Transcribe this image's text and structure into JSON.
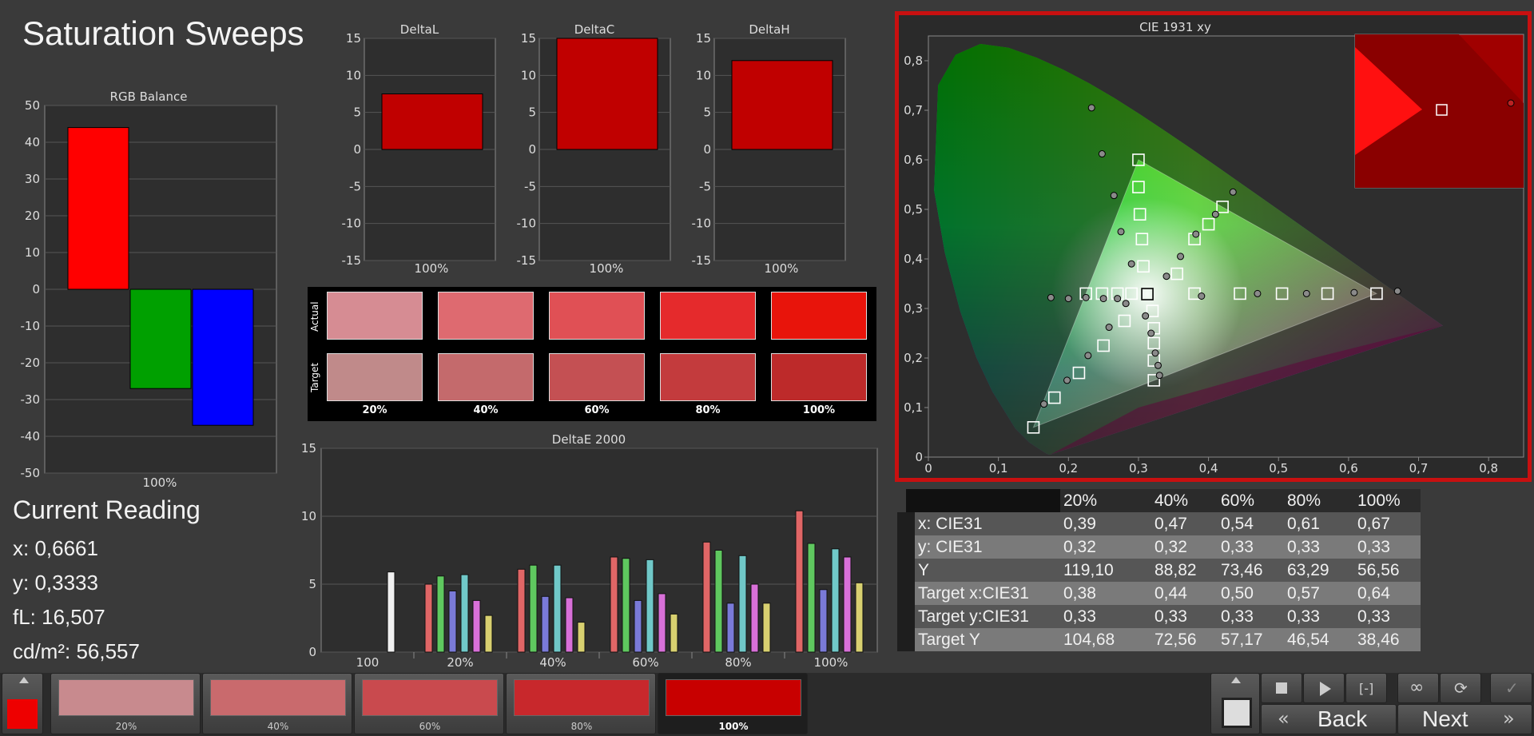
{
  "page_title": "Saturation Sweeps",
  "rgb_balance": {
    "title": "RGB Balance",
    "ylim": [
      -50,
      50
    ],
    "yticks": [
      50,
      40,
      30,
      20,
      10,
      0,
      -10,
      -20,
      -30,
      -40,
      -50
    ],
    "xlabel": "100%",
    "colors": [
      "#ff0000",
      "#00a000",
      "#0000ff"
    ]
  },
  "delta_charts": [
    {
      "title": "DeltaL",
      "xlabel": "100%",
      "value": 7.5
    },
    {
      "title": "DeltaC",
      "xlabel": "100%",
      "value": 15
    },
    {
      "title": "DeltaH",
      "xlabel": "100%",
      "value": 12
    }
  ],
  "delta_yticks": [
    15,
    10,
    5,
    0,
    -5,
    -10,
    -15
  ],
  "swatches": {
    "row_labels": [
      "Actual",
      "Target"
    ],
    "labels": [
      "20%",
      "40%",
      "60%",
      "80%",
      "100%"
    ],
    "actual": [
      "#d68c93",
      "#de6a70",
      "#e05055",
      "#e52a2c",
      "#e8140b"
    ],
    "target": [
      "#c08a8a",
      "#c46a6c",
      "#c45053",
      "#c33b3d",
      "#bd2a2a"
    ]
  },
  "current_reading": {
    "title": "Current Reading",
    "x": "x: 0,6661",
    "y": "y: 0,3333",
    "fl": "fL: 16,507",
    "cdm2": "cd/m²: 56,557"
  },
  "cie_title": "CIE 1931 xy",
  "cie_xticks": [
    "0",
    "0,1",
    "0,2",
    "0,3",
    "0,4",
    "0,5",
    "0,6",
    "0,7",
    "0,8"
  ],
  "cie_yticks": [
    "0",
    "0,1",
    "0,2",
    "0,3",
    "0,4",
    "0,5",
    "0,6",
    "0,7",
    "0,8"
  ],
  "table": {
    "headers": [
      "",
      "20%",
      "40%",
      "60%",
      "80%",
      "100%"
    ],
    "rows": [
      [
        "x: CIE31",
        "0,39",
        "0,47",
        "0,54",
        "0,61",
        "0,67"
      ],
      [
        "y: CIE31",
        "0,32",
        "0,32",
        "0,33",
        "0,33",
        "0,33"
      ],
      [
        "Y",
        "119,10",
        "88,82",
        "73,46",
        "63,29",
        "56,56"
      ],
      [
        "Target x:CIE31",
        "0,38",
        "0,44",
        "0,50",
        "0,57",
        "0,64"
      ],
      [
        "Target y:CIE31",
        "0,33",
        "0,33",
        "0,33",
        "0,33",
        "0,33"
      ],
      [
        "Target Y",
        "104,68",
        "72,56",
        "57,17",
        "46,54",
        "38,46"
      ]
    ]
  },
  "bottom_bar": {
    "steps": [
      "20%",
      "40%",
      "60%",
      "80%",
      "100%"
    ],
    "step_colors": [
      "#c88a8e",
      "#c96a6d",
      "#c94a4e",
      "#c8282c",
      "#c80000"
    ],
    "back": "Back",
    "next": "Next"
  },
  "chart_data": [
    {
      "type": "bar",
      "title": "RGB Balance",
      "categories": [
        "100%"
      ],
      "series": [
        {
          "values": [
            44
          ]
        },
        {
          "values": [
            -27
          ]
        },
        {
          "values": [
            -37
          ]
        }
      ],
      "ylim": [
        -50,
        50
      ]
    },
    {
      "type": "bar",
      "title": "DeltaL",
      "categories": [
        "100%"
      ],
      "values": [
        7.5
      ],
      "ylim": [
        -15,
        15
      ]
    },
    {
      "type": "bar",
      "title": "DeltaC",
      "categories": [
        "100%"
      ],
      "values": [
        15
      ],
      "ylim": [
        -15,
        15
      ]
    },
    {
      "type": "bar",
      "title": "DeltaH",
      "categories": [
        "100%"
      ],
      "values": [
        12
      ],
      "ylim": [
        -15,
        15
      ]
    },
    {
      "type": "bar",
      "title": "DeltaE 2000",
      "categories": [
        "100",
        "20%",
        "40%",
        "60%",
        "80%",
        "100%"
      ],
      "ylim": [
        0,
        15
      ],
      "yticks": [
        0,
        5,
        10,
        15
      ],
      "series": [
        {
          "color": "#f0f0f0",
          "values": [
            5.9,
            0,
            0,
            0,
            0,
            0
          ]
        },
        {
          "color": "#e06666",
          "values": [
            0,
            5.0,
            6.1,
            7.0,
            8.1,
            10.4
          ]
        },
        {
          "color": "#5fc85f",
          "values": [
            0,
            5.6,
            6.4,
            6.9,
            7.5,
            8.0
          ]
        },
        {
          "color": "#7a7ad8",
          "values": [
            0,
            4.5,
            4.1,
            3.8,
            3.6,
            4.6
          ]
        },
        {
          "color": "#70c8c8",
          "values": [
            0,
            5.7,
            6.4,
            6.8,
            7.1,
            7.6
          ]
        },
        {
          "color": "#d870d8",
          "values": [
            0,
            3.8,
            4.0,
            4.3,
            5.0,
            7.0
          ]
        },
        {
          "color": "#d8d070",
          "values": [
            0,
            2.7,
            2.2,
            2.8,
            3.6,
            5.1
          ]
        }
      ]
    },
    {
      "type": "scatter",
      "title": "CIE 1931 xy",
      "xlim": [
        0,
        0.85
      ],
      "ylim": [
        0,
        0.85
      ],
      "gamut_triangle": [
        [
          0.64,
          0.33
        ],
        [
          0.3,
          0.6
        ],
        [
          0.15,
          0.06
        ]
      ],
      "white_point": [
        0.3127,
        0.329
      ],
      "targets": [
        [
          0.64,
          0.33
        ],
        [
          0.57,
          0.33
        ],
        [
          0.505,
          0.33
        ],
        [
          0.445,
          0.33
        ],
        [
          0.38,
          0.33
        ],
        [
          0.3,
          0.6
        ],
        [
          0.3,
          0.545
        ],
        [
          0.302,
          0.49
        ],
        [
          0.305,
          0.44
        ],
        [
          0.307,
          0.385
        ],
        [
          0.15,
          0.06
        ],
        [
          0.18,
          0.12
        ],
        [
          0.215,
          0.17
        ],
        [
          0.25,
          0.225
        ],
        [
          0.28,
          0.275
        ],
        [
          0.42,
          0.505
        ],
        [
          0.4,
          0.47
        ],
        [
          0.38,
          0.44
        ],
        [
          0.355,
          0.37
        ],
        [
          0.225,
          0.33
        ],
        [
          0.248,
          0.33
        ],
        [
          0.27,
          0.33
        ],
        [
          0.29,
          0.33
        ],
        [
          0.32,
          0.295
        ],
        [
          0.322,
          0.26
        ],
        [
          0.322,
          0.23
        ],
        [
          0.322,
          0.195
        ],
        [
          0.322,
          0.155
        ]
      ],
      "actual": [
        [
          0.67,
          0.335
        ],
        [
          0.608,
          0.332
        ],
        [
          0.54,
          0.33
        ],
        [
          0.47,
          0.33
        ],
        [
          0.39,
          0.325
        ],
        [
          0.233,
          0.705
        ],
        [
          0.248,
          0.612
        ],
        [
          0.265,
          0.528
        ],
        [
          0.275,
          0.455
        ],
        [
          0.29,
          0.39
        ],
        [
          0.165,
          0.107
        ],
        [
          0.198,
          0.155
        ],
        [
          0.228,
          0.205
        ],
        [
          0.258,
          0.262
        ],
        [
          0.282,
          0.31
        ],
        [
          0.435,
          0.535
        ],
        [
          0.41,
          0.49
        ],
        [
          0.382,
          0.45
        ],
        [
          0.36,
          0.405
        ],
        [
          0.34,
          0.365
        ],
        [
          0.175,
          0.322
        ],
        [
          0.2,
          0.32
        ],
        [
          0.225,
          0.322
        ],
        [
          0.25,
          0.32
        ],
        [
          0.27,
          0.32
        ],
        [
          0.31,
          0.285
        ],
        [
          0.318,
          0.25
        ],
        [
          0.324,
          0.21
        ],
        [
          0.328,
          0.185
        ],
        [
          0.33,
          0.165
        ]
      ]
    }
  ]
}
